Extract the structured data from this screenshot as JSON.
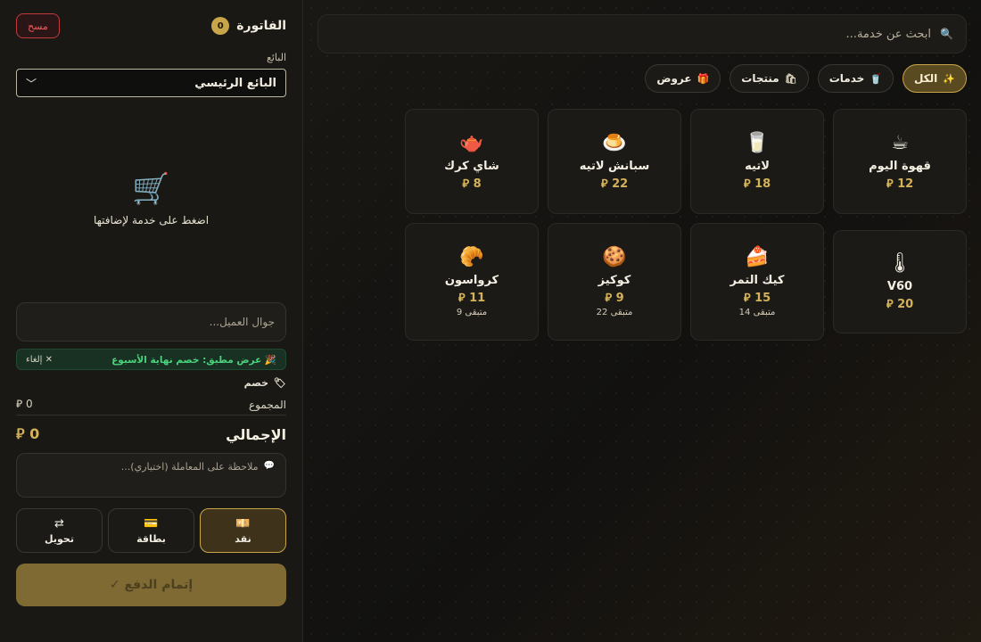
{
  "catalog": {
    "search": {
      "placeholder": "ابحث عن خدمة...",
      "icon": "search-icon"
    },
    "filters": [
      {
        "label": "الكل",
        "icon": "sparkle-icon",
        "active": true
      },
      {
        "label": "خدمات",
        "icon": "cup-icon"
      },
      {
        "label": "منتجات",
        "icon": "bag-icon"
      },
      {
        "label": "عروض",
        "icon": "gift-icon"
      }
    ],
    "products": [
      {
        "name": "قهوة اليوم",
        "price": "12 ⃁",
        "icon": "coffee-cup-icon"
      },
      {
        "name": "لاتيه",
        "price": "18 ⃁",
        "icon": "latte-glass-icon"
      },
      {
        "name": "سبانش لاتيه",
        "price": "22 ⃁",
        "icon": "spanish-latte-icon"
      },
      {
        "name": "شاي كرك",
        "price": "8 ⃁",
        "icon": "teapot-icon"
      },
      {
        "name": "V60",
        "price": "20 ⃁",
        "icon": "v60-dripper-icon"
      },
      {
        "name": "كيك التمر",
        "price": "15 ⃁",
        "stock": "متبقى 14",
        "icon": "cake-icon"
      },
      {
        "name": "كوكيز",
        "price": "9 ⃁",
        "stock": "متبقى 22",
        "icon": "cookie-icon"
      },
      {
        "name": "كرواسون",
        "price": "11 ⃁",
        "stock": "متبقى 9",
        "icon": "croissant-icon"
      }
    ]
  },
  "cart": {
    "title": "الفاتورة",
    "count": "0",
    "clear_label": "مسح",
    "seller_label": "البائع",
    "seller_value": "البائع الرئيسي",
    "empty_message": "اضغط على خدمة لإضافتها",
    "phone_placeholder": "جوال العميل...",
    "offer_text": "عرض مطبق: خصم نهاية الأسبوع",
    "offer_cancel": "✕ إلغاء",
    "discount_label": "خصم",
    "subtotal_label": "المجموع",
    "subtotal_value": "0 ⃁",
    "total_label": "الإجمالي",
    "total_value": "0 ⃁",
    "note_placeholder": "ملاحظة على المعاملة (اختياري)...",
    "payment_methods": [
      {
        "label": "نقد",
        "icon": "cash-icon",
        "active": true
      },
      {
        "label": "بطاقة",
        "icon": "card-icon"
      },
      {
        "label": "تحويل",
        "icon": "transfer-icon"
      }
    ],
    "checkout_label": "إتمام الدفع ✓"
  },
  "colors": {
    "accent": "#c9a54a",
    "price": "#d4b25a",
    "offer_green": "#4bd37b",
    "danger": "#ef5b5b"
  }
}
